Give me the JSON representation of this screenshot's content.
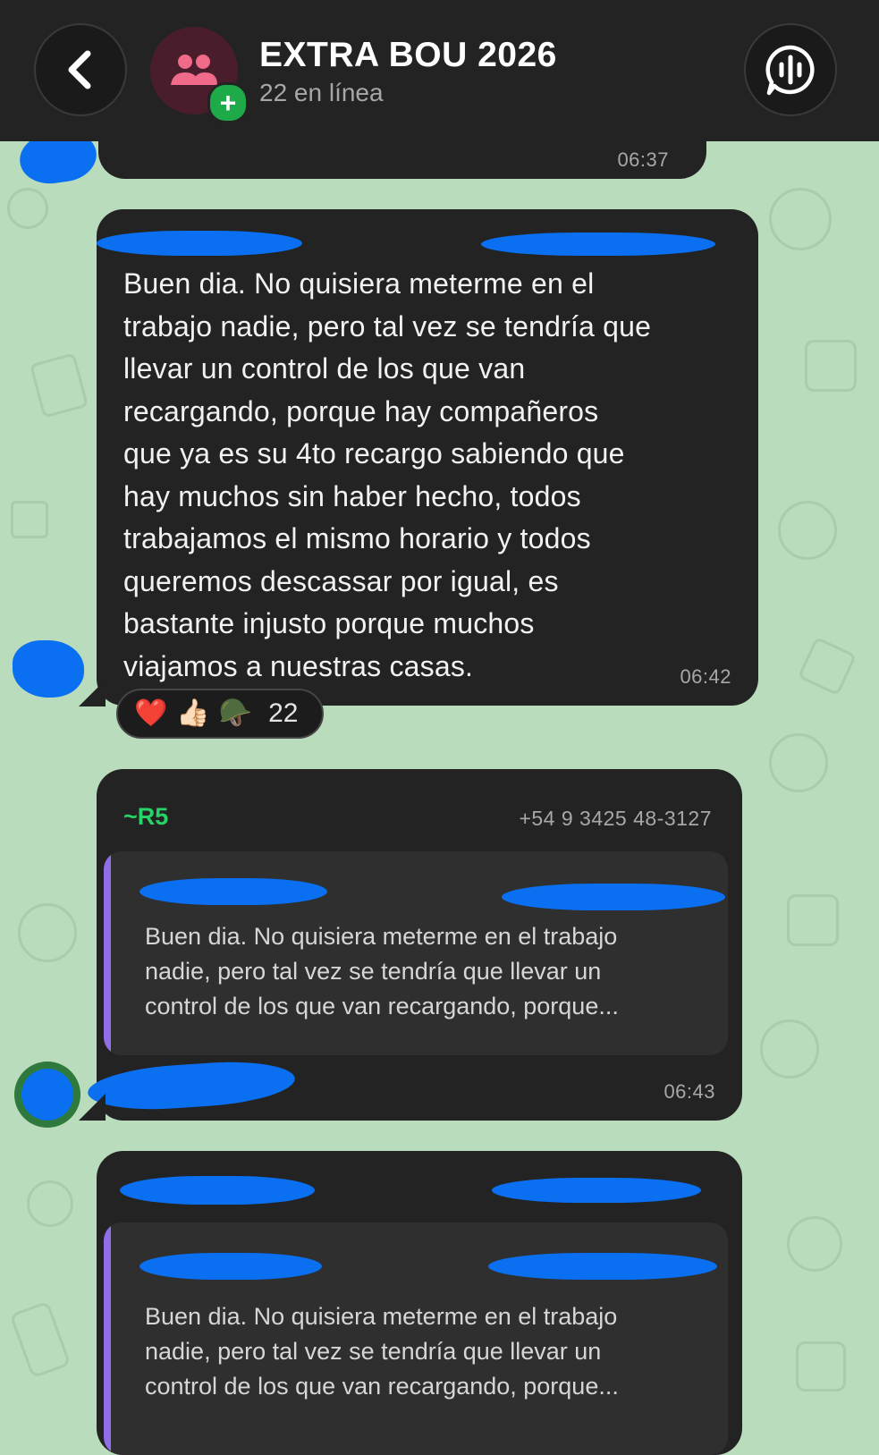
{
  "header": {
    "title": "EXTRA BOU 2026",
    "subtitle": "22 en línea",
    "add_badge": "+"
  },
  "messages": [
    {
      "time": "06:37"
    },
    {
      "text_lines": [
        "Buen dia. No quisiera meterme en el",
        "trabajo nadie, pero tal vez se tendría que",
        "llevar un control de los que van",
        "recargando, porque hay compañeros",
        "que ya es su 4to recargo sabiendo que",
        "hay muchos sin haber hecho, todos",
        "trabajamos el mismo horario y todos",
        "queremos descassar por igual, es",
        "bastante injusto porque muchos",
        "viajamos a nuestras casas."
      ],
      "time": "06:42",
      "reactions": [
        "❤️",
        "👍🏻",
        "🪖"
      ],
      "reaction_count": "22"
    },
    {
      "sender": "~R5",
      "phone": "+54 9 3425 48-3127",
      "quote_lines": [
        "Buen dia. No quisiera meterme en el trabajo",
        "nadie, pero tal vez se tendría que llevar un",
        "control de los que van recargando, porque..."
      ],
      "time": "06:43"
    },
    {
      "quote_lines": [
        "Buen dia. No quisiera meterme en el trabajo",
        "nadie, pero tal vez se tendría que llevar un",
        "control de los que van recargando, porque..."
      ]
    }
  ],
  "colors": {
    "wallpaper": "#b9dcbd",
    "bubble": "#232323",
    "sender_green": "#25d366",
    "quote_bar": "#8f6ee8",
    "redaction": "#0a6ff0"
  },
  "icons": {
    "back": "chevron-left-icon",
    "group": "group-icon",
    "voice_chat": "voice-chat-icon"
  }
}
